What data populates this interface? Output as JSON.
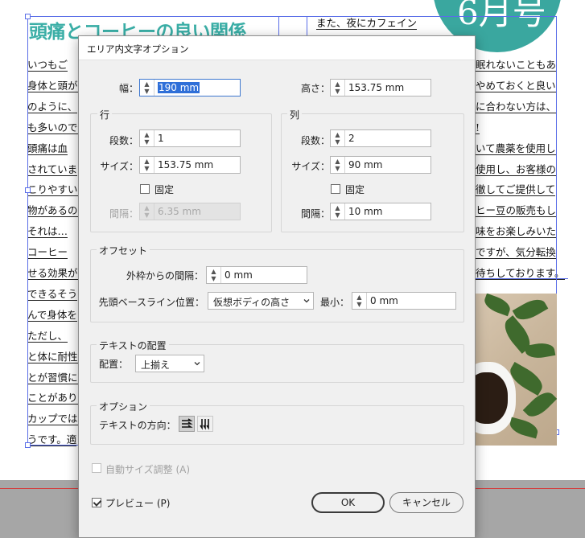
{
  "document": {
    "headline": "頭痛とコーヒーの良い関係",
    "badge_text": "6月号",
    "left_col_lines": [
      "いつもご",
      "身体と頭が",
      "のように、",
      "も多いので",
      "頭痛は血",
      "されていま",
      "こりやすい",
      "物があるの",
      "それは…",
      "コーヒー",
      "せる効果が",
      "できるそう",
      "んで身体を",
      "ただし、",
      "と体に耐性",
      "とが習慣に",
      "ことがあり",
      "カップでは",
      "うです。適"
    ],
    "right_col_top": "また、夜にカフェイン",
    "right_col_lines": [
      "眠れないこともあ",
      "やめておくと良い",
      "に合わない方は、",
      "!",
      "いて農薬を使用し",
      "使用し、お客様の",
      "徹してご提供して",
      "ヒー豆の販売もし",
      "味をお楽しみいた",
      "ですが、気分転換",
      "待ちしております。"
    ]
  },
  "dialog": {
    "title": "エリア内文字オプション",
    "width_label": "幅：",
    "width_value": "190 mm",
    "height_label": "高さ：",
    "height_value": "153.75 mm",
    "rows": {
      "title": "行",
      "count_label": "段数：",
      "count_value": "1",
      "size_label": "サイズ：",
      "size_value": "153.75 mm",
      "fixed_label": "固定",
      "gutter_label": "間隔：",
      "gutter_value": "6.35 mm"
    },
    "columns": {
      "title": "列",
      "count_label": "段数：",
      "count_value": "2",
      "size_label": "サイズ：",
      "size_value": "90 mm",
      "fixed_label": "固定",
      "gutter_label": "間隔：",
      "gutter_value": "10 mm"
    },
    "offset": {
      "title": "オフセット",
      "inset_label": "外枠からの間隔：",
      "inset_value": "0 mm",
      "baseline_label": "先頭ベースライン位置：",
      "baseline_value": "仮想ボディの高さ",
      "min_label": "最小：",
      "min_value": "0 mm"
    },
    "alignment": {
      "title": "テキストの配置",
      "align_label": "配置：",
      "align_value": "上揃え"
    },
    "options": {
      "title": "オプション",
      "flow_label": "テキストの方向："
    },
    "auto_size_label": "自動サイズ調整 (A)",
    "preview_label": "プレビュー (P)",
    "ok_label": "OK",
    "cancel_label": "キャンセル"
  }
}
